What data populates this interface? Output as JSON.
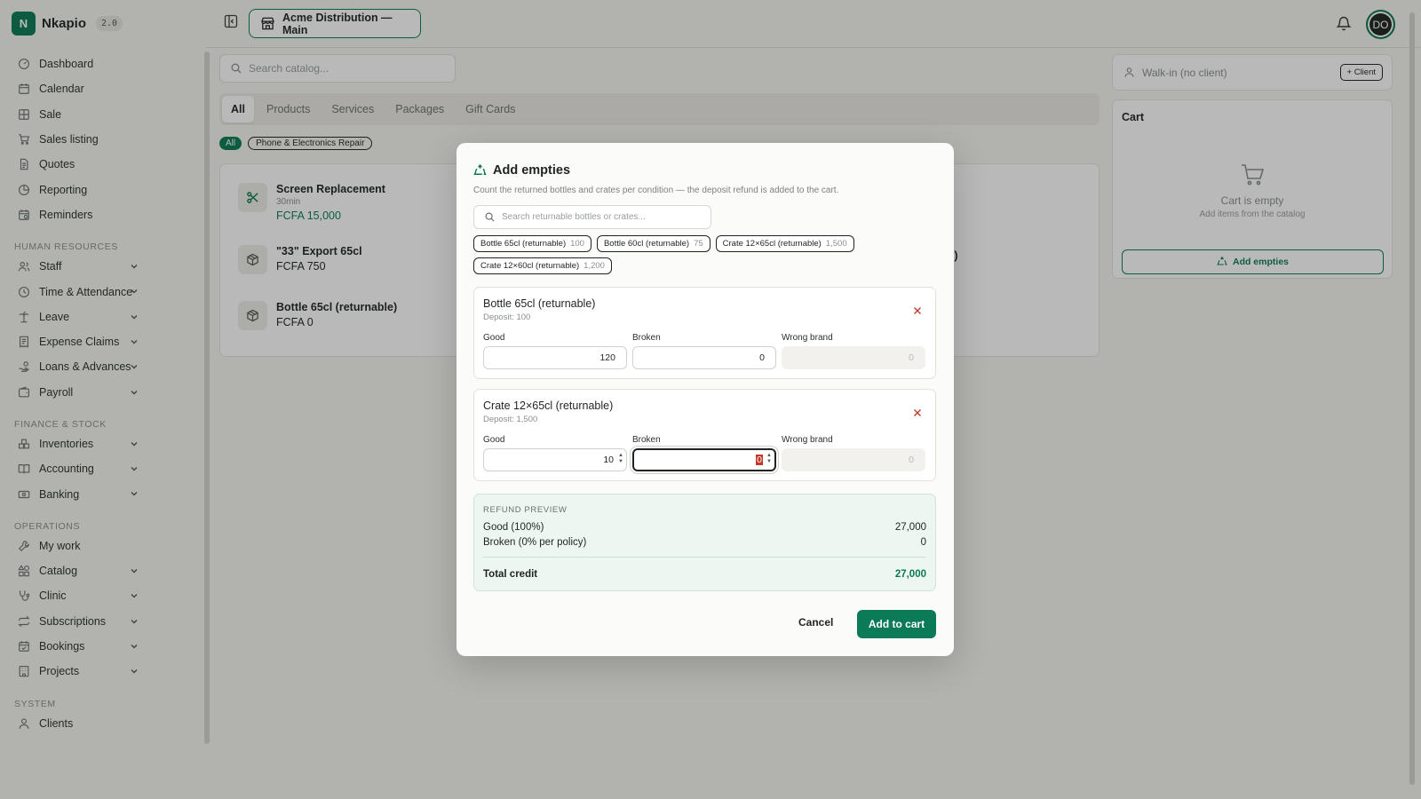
{
  "brand": {
    "initial": "N",
    "name": "Nkapio",
    "version": "2.0"
  },
  "sidebar": {
    "top_items": [
      {
        "label": "Dashboard",
        "icon": "gauge-icon"
      },
      {
        "label": "Calendar",
        "icon": "calendar-icon"
      },
      {
        "label": "Sale",
        "icon": "grid-icon"
      },
      {
        "label": "Sales listing",
        "icon": "cart-icon"
      },
      {
        "label": "Quotes",
        "icon": "document-icon"
      },
      {
        "label": "Reporting",
        "icon": "pie-chart-icon"
      },
      {
        "label": "Reminders",
        "icon": "calendar-clock-icon"
      }
    ],
    "hr_title": "HUMAN RESOURCES",
    "hr_items": [
      {
        "label": "Staff",
        "icon": "users-icon"
      },
      {
        "label": "Time & Attendance",
        "icon": "clock-icon"
      },
      {
        "label": "Leave",
        "icon": "palm-tree-icon"
      },
      {
        "label": "Expense Claims",
        "icon": "receipt-icon"
      },
      {
        "label": "Loans & Advances",
        "icon": "hand-coins-icon"
      },
      {
        "label": "Payroll",
        "icon": "wallet-icon"
      }
    ],
    "fin_title": "FINANCE & STOCK",
    "fin_items": [
      {
        "label": "Inventories",
        "icon": "boxes-icon"
      },
      {
        "label": "Accounting",
        "icon": "book-icon"
      },
      {
        "label": "Banking",
        "icon": "banknote-icon"
      }
    ],
    "ops_title": "OPERATIONS",
    "ops_items": [
      {
        "label": "My work",
        "icon": "wrench-icon"
      },
      {
        "label": "Catalog",
        "icon": "shapes-icon"
      },
      {
        "label": "Clinic",
        "icon": "stethoscope-icon"
      },
      {
        "label": "Subscriptions",
        "icon": "repeat-icon"
      },
      {
        "label": "Bookings",
        "icon": "calendar-check-icon"
      },
      {
        "label": "Projects",
        "icon": "building-icon"
      }
    ],
    "sys_title": "SYSTEM",
    "sys_items": [
      {
        "label": "Clients",
        "icon": "user-icon"
      }
    ]
  },
  "topbar": {
    "location": "Acme Distribution — Main",
    "avatar_initials": "DO"
  },
  "catalog": {
    "search_placeholder": "Search catalog...",
    "tabs": [
      "All",
      "Products",
      "Services",
      "Packages",
      "Gift Cards"
    ],
    "chips": [
      "All",
      "Phone & Electronics Repair"
    ],
    "products": [
      {
        "name": "Screen Replacement",
        "sub": "30min",
        "price": "FCFA 15,000"
      },
      {
        "name": "\"33\" Export 65cl",
        "price": "FCFA 750"
      },
      {
        "name": "Bottle 65cl (returnable)",
        "price": "FCFA 0"
      }
    ],
    "partial_text": "le)"
  },
  "client": {
    "placeholder": "Walk-in (no client)",
    "add_label": "+ Client"
  },
  "cart": {
    "title": "Cart",
    "empty_title": "Cart is empty",
    "empty_sub": "Add items from the catalog",
    "add_empties_label": "Add empties"
  },
  "modal": {
    "title": "Add empties",
    "description": "Count the returned bottles and crates per condition — the deposit refund is added to the cart.",
    "search_placeholder": "Search returnable bottles or crates...",
    "chips": [
      {
        "name": "Bottle 65cl (returnable)",
        "deposit": "100"
      },
      {
        "name": "Bottle 60cl (returnable)",
        "deposit": "75"
      },
      {
        "name": "Crate 12×65cl (returnable)",
        "deposit": "1,500"
      },
      {
        "name": "Crate 12×60cl (returnable)",
        "deposit": "1,200"
      }
    ],
    "field_labels": {
      "good": "Good",
      "broken": "Broken",
      "wrong": "Wrong brand"
    },
    "items": [
      {
        "name": "Bottle 65cl (returnable)",
        "deposit": "Deposit: 100",
        "good": "120",
        "broken": "0",
        "wrong": "0"
      },
      {
        "name": "Crate 12×65cl (returnable)",
        "deposit": "Deposit: 1,500",
        "good": "10",
        "broken": "0",
        "wrong": "0"
      }
    ],
    "refund": {
      "heading": "REFUND PREVIEW",
      "good_label": "Good (100%)",
      "good_value": "27,000",
      "broken_label": "Broken (0% per policy)",
      "broken_value": "0",
      "total_label": "Total credit",
      "total_value": "27,000"
    },
    "cancel_label": "Cancel",
    "add_label": "Add to cart"
  }
}
